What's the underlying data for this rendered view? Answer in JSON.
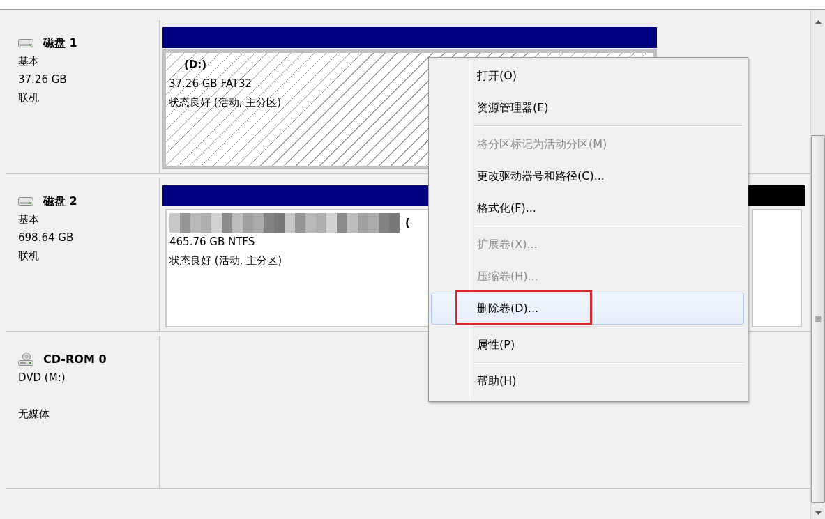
{
  "disks": [
    {
      "kind": "disk",
      "name": "磁盘 1",
      "type": "基本",
      "size": "37.26 GB",
      "status": "联机",
      "partitions": [
        {
          "color": "#000080",
          "selected": true,
          "label": "(D:)",
          "blurred": false,
          "info": "37.26 GB FAT32",
          "health": "状态良好 (活动, 主分区)"
        }
      ]
    },
    {
      "kind": "disk",
      "name": "磁盘 2",
      "type": "基本",
      "size": "698.64 GB",
      "status": "联机",
      "partitions": [
        {
          "color": "#000080",
          "selected": false,
          "label": "(",
          "blurred": true,
          "info": "465.76 GB NTFS",
          "health": "状态良好 (活动, 主分区)"
        },
        {
          "color": "#000000",
          "selected": false
        }
      ]
    },
    {
      "kind": "cdrom",
      "name": "CD-ROM 0",
      "type": "DVD (M:)",
      "status": "无媒体"
    }
  ],
  "context_menu": [
    {
      "kind": "item",
      "label": "打开(O)",
      "disabled": false,
      "selected": false,
      "annotated": false
    },
    {
      "kind": "item",
      "label": "资源管理器(E)",
      "disabled": false,
      "selected": false,
      "annotated": false
    },
    {
      "kind": "separator"
    },
    {
      "kind": "item",
      "label": "将分区标记为活动分区(M)",
      "disabled": true,
      "selected": false,
      "annotated": false
    },
    {
      "kind": "item",
      "label": "更改驱动器号和路径(C)...",
      "disabled": false,
      "selected": false,
      "annotated": false
    },
    {
      "kind": "item",
      "label": "格式化(F)...",
      "disabled": false,
      "selected": false,
      "annotated": false
    },
    {
      "kind": "separator"
    },
    {
      "kind": "item",
      "label": "扩展卷(X)...",
      "disabled": true,
      "selected": false,
      "annotated": false
    },
    {
      "kind": "item",
      "label": "压缩卷(H)...",
      "disabled": true,
      "selected": false,
      "annotated": false
    },
    {
      "kind": "item",
      "label": "删除卷(D)...",
      "disabled": false,
      "selected": true,
      "annotated": true
    },
    {
      "kind": "separator"
    },
    {
      "kind": "item",
      "label": "属性(P)",
      "disabled": false,
      "selected": false,
      "annotated": false
    },
    {
      "kind": "separator"
    },
    {
      "kind": "item",
      "label": "帮助(H)",
      "disabled": false,
      "selected": false,
      "annotated": false
    }
  ]
}
